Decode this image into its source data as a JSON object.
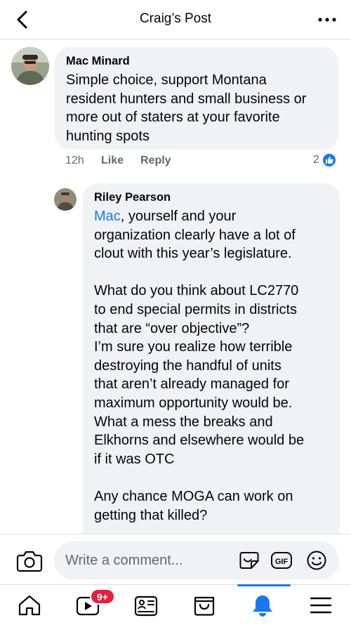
{
  "header": {
    "title": "Craig’s Post"
  },
  "comment": {
    "author": "Mac Minard",
    "text": "Simple choice, support Montana\nresident hunters and small business or\nmore out of staters at your favorite\nhunting spots",
    "time": "12h",
    "like_label": "Like",
    "reply_label": "Reply",
    "reaction_count": "2"
  },
  "reply": {
    "author": "Riley Pearson",
    "mention": "Mac",
    "text_after_mention": ", yourself and your\norganization clearly have a lot of\nclout with this year’s legislature.\n\nWhat do you think about LC2770\nto end special permits in districts\nthat are “over objective”?\nI’m sure you realize how terrible\ndestroying the handful of units\nthat aren’t already managed for\nmaximum opportunity would be.\nWhat a mess the breaks and\nElkhorns and elsewhere would be\nif it was OTC\n\nAny chance MOGA can work on\ngetting that killed?"
  },
  "composer": {
    "placeholder": "Write a comment..."
  },
  "tabs": [
    {
      "name": "home",
      "icon": "home-icon"
    },
    {
      "name": "watch",
      "icon": "video-icon",
      "badge": "9+"
    },
    {
      "name": "news",
      "icon": "news-icon"
    },
    {
      "name": "marketplace",
      "icon": "marketplace-icon"
    },
    {
      "name": "notifications",
      "icon": "bell-icon",
      "active": true
    },
    {
      "name": "menu",
      "icon": "menu-icon"
    }
  ],
  "colors": {
    "accent": "#1877f2",
    "bubble": "#f0f2f5",
    "secondary_text": "#65676b",
    "badge": "#e41e3f"
  }
}
